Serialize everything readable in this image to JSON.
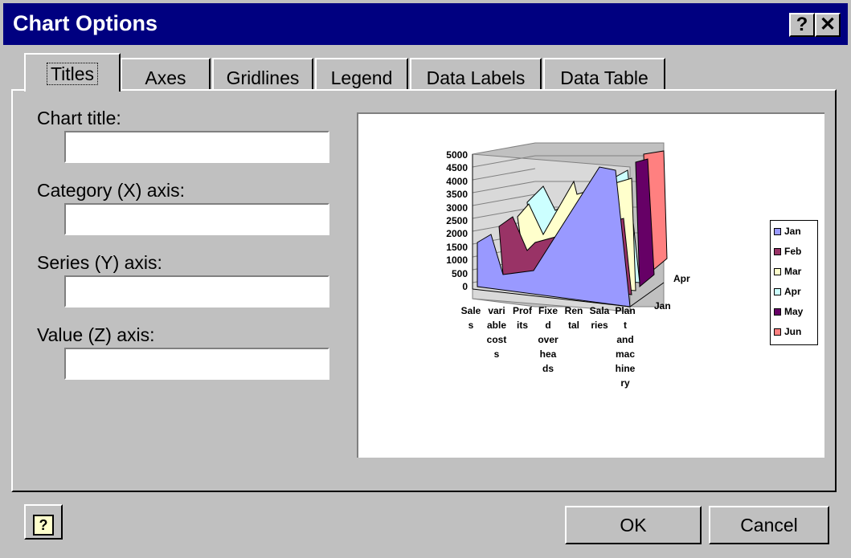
{
  "window": {
    "title": "Chart Options",
    "help_glyph": "?",
    "close_glyph": "✕"
  },
  "tabs": [
    {
      "label": "Titles"
    },
    {
      "label": "Axes"
    },
    {
      "label": "Gridlines"
    },
    {
      "label": "Legend"
    },
    {
      "label": "Data Labels"
    },
    {
      "label": "Data Table"
    }
  ],
  "form": {
    "chart_title_label": "Chart title:",
    "category_axis_label": "Category (X) axis:",
    "series_axis_label": "Series (Y) axis:",
    "value_axis_label": "Value (Z) axis:",
    "chart_title_value": "",
    "category_axis_value": "",
    "series_axis_value": "",
    "value_axis_value": ""
  },
  "buttons": {
    "help_glyph": "?",
    "ok": "OK",
    "cancel": "Cancel"
  },
  "chart_data": {
    "type": "area",
    "z_ticks": [
      "5000",
      "4500",
      "4000",
      "3500",
      "3000",
      "2500",
      "2000",
      "1500",
      "1000",
      "500",
      "0"
    ],
    "categories": [
      "Sale\ns",
      "vari\nable\ncost\ns",
      "Prof\nits",
      "Fixe\nd\nover\nhea\nds",
      "Ren\ntal",
      "Sala\nries",
      "Plan\nt\nand\nmac\nhine\nry"
    ],
    "y_labels": [
      "Apr",
      "Jan"
    ],
    "series": [
      {
        "name": "Jan",
        "color": "#9999ff"
      },
      {
        "name": "Feb",
        "color": "#993366"
      },
      {
        "name": "Mar",
        "color": "#ffffcc"
      },
      {
        "name": "Apr",
        "color": "#ccffff"
      },
      {
        "name": "May",
        "color": "#660066"
      },
      {
        "name": "Jun",
        "color": "#ff8080"
      }
    ]
  }
}
